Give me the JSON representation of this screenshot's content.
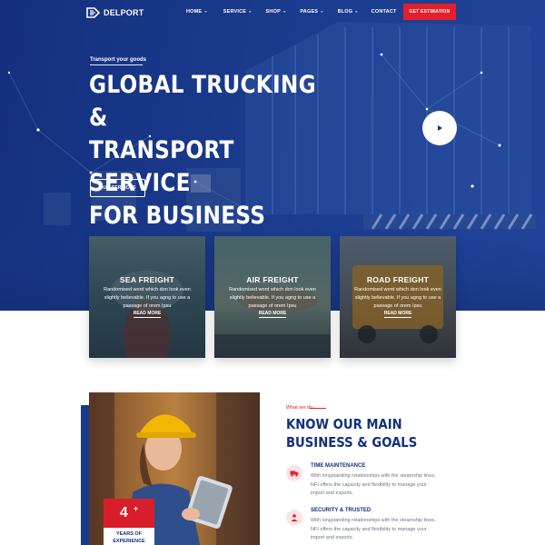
{
  "header": {
    "logo_text": "DELPORT",
    "nav": [
      {
        "label": "HOME"
      },
      {
        "label": "SERVICE"
      },
      {
        "label": "SHOP"
      },
      {
        "label": "PAGES"
      },
      {
        "label": "BLOG"
      },
      {
        "label": "CONTACT"
      }
    ],
    "cta_label": "GET ESTIMATION"
  },
  "hero": {
    "kicker": "Transport your goods",
    "title_lines": [
      "GLOBAL TRUCKING &",
      "TRANSPORT SERVICE",
      "FOR BUSINESS"
    ],
    "button_label": "OUR SERVICES",
    "play_icon": "play-icon"
  },
  "services": [
    {
      "title": "SEA FREIGHT",
      "description": "Randomised word which don look even slightly believable. If you agng to use a passage of orem Ipsu",
      "link": "READ MORE"
    },
    {
      "title": "AIR FREIGHT",
      "description": "Randomised word which don look even slightly believable. If you agng to use a passage of orem Ipsu",
      "link": "READ MORE"
    },
    {
      "title": "ROAD FREIGHT",
      "description": "Randomised word which don look even slightly believable. If you agng to use a passage of orem Ipsu",
      "link": "READ MORE"
    }
  ],
  "about": {
    "experience_number": "4",
    "experience_plus": "+",
    "experience_label_1": "YEARS OF",
    "experience_label_2": "EXPERIENCE",
    "kicker": "What we do",
    "title_line_1": "KNOW OUR MAIN",
    "title_line_2": "BUSINESS & GOALS",
    "features": [
      {
        "icon": "truck-icon",
        "title": "TIME MAINTENANCE",
        "desc_1": "With longstanding relationships with the steamship lines,",
        "desc_2": "NFI offers the capacity and flexibility to manage your",
        "desc_3": "import and exports."
      },
      {
        "icon": "users-icon",
        "title": "SECURITY & TRUSTED",
        "desc_1": "With longstanding relationships with the steamship lines,",
        "desc_2": "NFI offers the capacity and flexibility to manage your",
        "desc_3": "import and exports."
      }
    ]
  },
  "colors": {
    "primary_blue": "#14307e",
    "accent_red": "#e41f2d",
    "white": "#ffffff"
  }
}
